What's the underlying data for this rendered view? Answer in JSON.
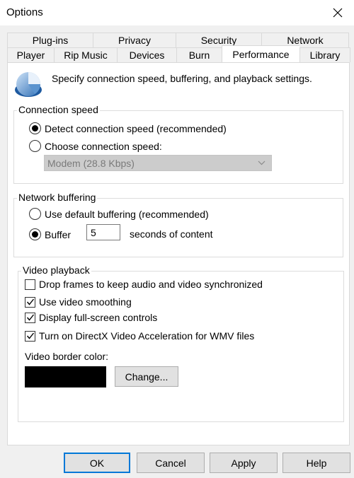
{
  "window": {
    "title": "Options"
  },
  "tabs": {
    "back_row": [
      "Plug-ins",
      "Privacy",
      "Security",
      "Network"
    ],
    "front_row": [
      "Player",
      "Rip Music",
      "Devices",
      "Burn",
      "Performance",
      "Library"
    ],
    "active": "Performance"
  },
  "header": {
    "text": "Specify connection speed, buffering, and playback settings."
  },
  "connection": {
    "label": "Connection speed",
    "detect_label": "Detect connection speed (recommended)",
    "choose_label": "Choose connection speed:",
    "speed_value": "Modem (28.8 Kbps)",
    "selected": "detect"
  },
  "buffering": {
    "label": "Network buffering",
    "default_label": "Use default buffering (recommended)",
    "buffer_label": "Buffer",
    "buffer_value": "5",
    "suffix": "seconds of content",
    "selected": "buffer"
  },
  "video": {
    "label": "Video playback",
    "drop_frames": {
      "label": "Drop frames to keep audio and video synchronized",
      "checked": false
    },
    "smoothing": {
      "label": "Use video smoothing",
      "checked": true
    },
    "fullscreen": {
      "label": "Display full-screen controls",
      "checked": true
    },
    "directx": {
      "label": "Turn on DirectX Video Acceleration for WMV files",
      "checked": true
    },
    "border_color_label": "Video border color:",
    "border_color": "#000000",
    "change_label": "Change..."
  },
  "buttons": {
    "ok": "OK",
    "cancel": "Cancel",
    "apply": "Apply",
    "help": "Help"
  },
  "colors": {
    "focus_border": "#0078d7",
    "panel_bg": "#ffffff",
    "window_bg": "#f0f0f0"
  }
}
